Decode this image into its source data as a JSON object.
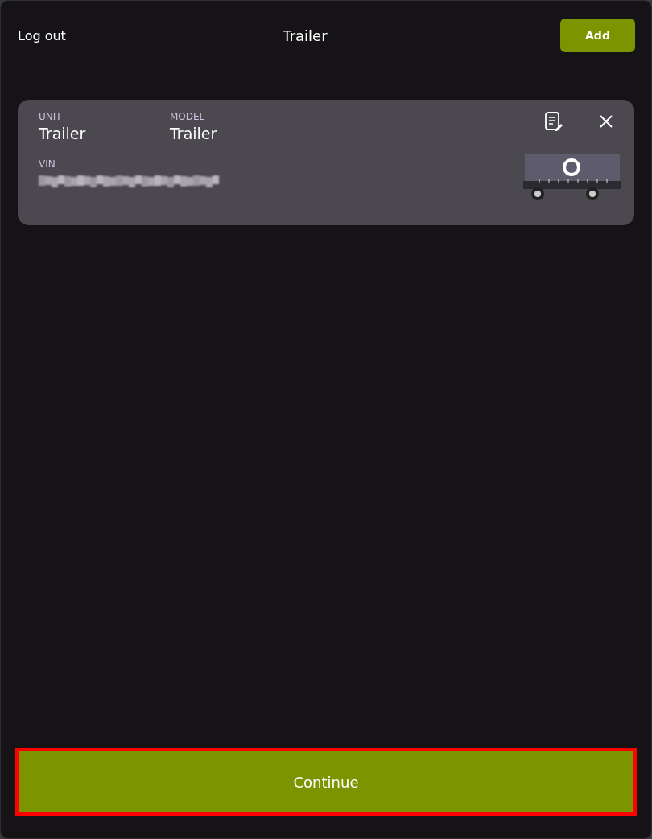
{
  "header": {
    "logout": "Log out",
    "title": "Trailer",
    "add_button": "Add"
  },
  "units": [
    {
      "unit_label": "UNIT",
      "unit": "Trailer",
      "model_label": "MODEL",
      "model": "Trailer",
      "vin_label": "VIN",
      "vin_redacted": true
    }
  ],
  "continue_button": {
    "label": "Continue",
    "highlighted": true
  }
}
